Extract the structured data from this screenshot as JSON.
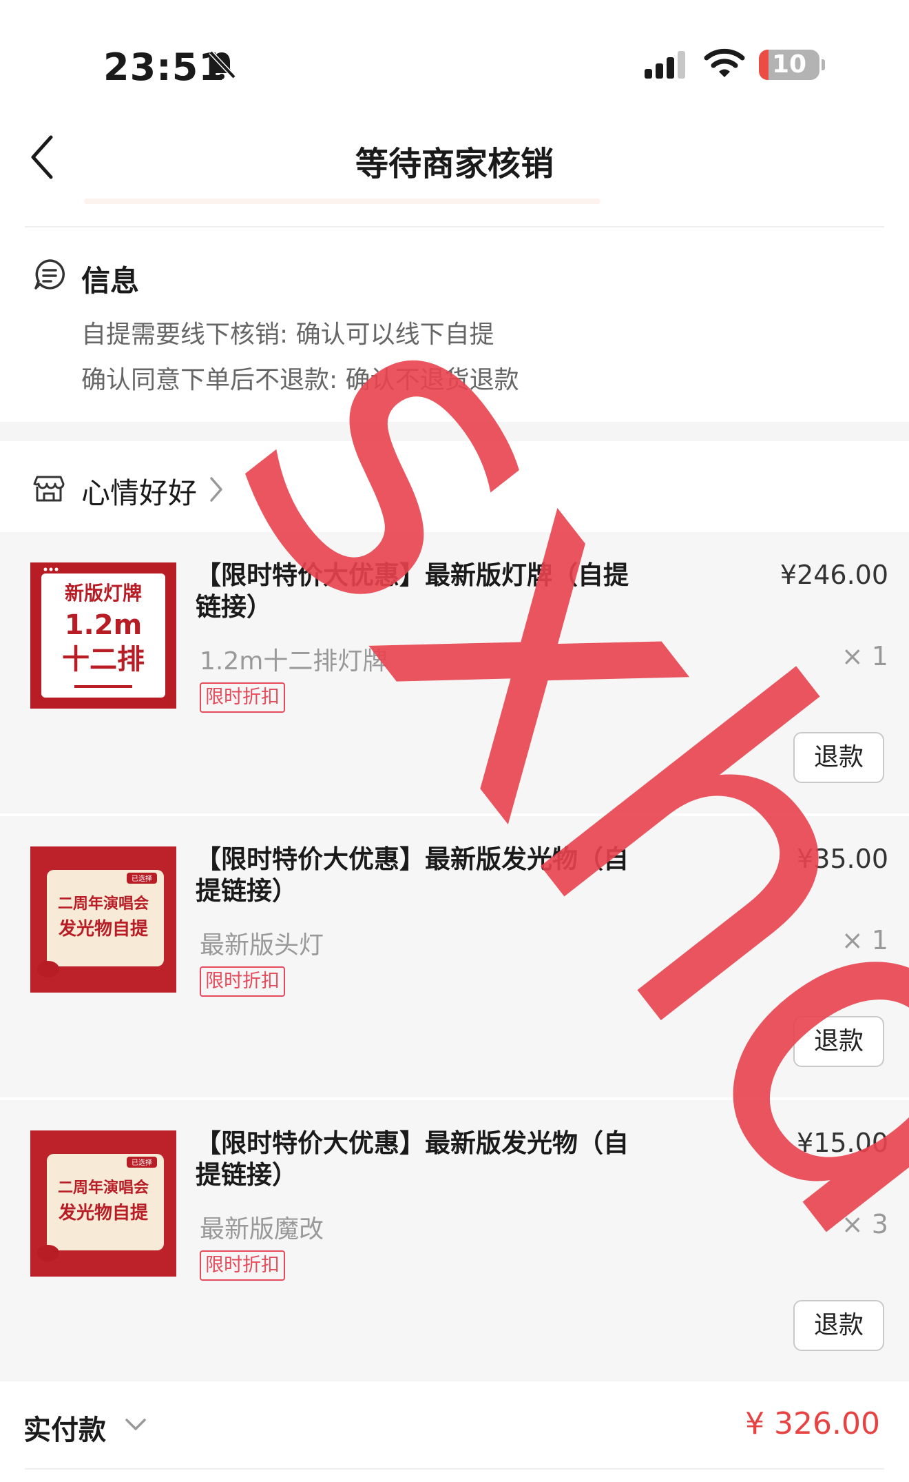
{
  "status_bar": {
    "time": "23:51",
    "battery": "10",
    "icons": [
      "bell-slash-icon",
      "signal-icon",
      "wifi-icon",
      "battery-icon"
    ]
  },
  "nav": {
    "title": "等待商家核销",
    "back_icon": "chevron-left-icon"
  },
  "info": {
    "title": "信息",
    "lines": [
      "自提需要线下核销: 确认可以线下自提",
      "确认同意下单后不退款: 确认不退货退款"
    ]
  },
  "shop": {
    "name": "心情好好"
  },
  "items": [
    {
      "title": "【限时特价大优惠】最新版灯牌（自提链接）",
      "price": "¥246.00",
      "spec": "1.2m十二排灯牌",
      "qty": "× 1",
      "tag": "限时折扣",
      "refund": "退款",
      "thumb": {
        "title": "新版灯牌",
        "size": "1.2m",
        "rows": "十二排"
      }
    },
    {
      "title": "【限时特价大优惠】最新版发光物（自提链接）",
      "price": "¥35.00",
      "spec": "最新版头灯",
      "qty": "× 1",
      "tag": "限时折扣",
      "refund": "退款",
      "thumb": {
        "badge": "已选择",
        "line1": "二周年演唱会",
        "line2": "发光物自提"
      }
    },
    {
      "title": "【限时特价大优惠】最新版发光物（自提链接）",
      "price": "¥15.00",
      "spec": "最新版魔改",
      "qty": "× 3",
      "tag": "限时折扣",
      "refund": "退款",
      "thumb": {
        "badge": "已选择",
        "line1": "二周年演唱会",
        "line2": "发光物自提"
      }
    }
  ],
  "total": {
    "label": "实付款",
    "value": "¥ 326.00"
  },
  "watermark": {
    "text": "sxhd"
  },
  "colors": {
    "accent": "#e84242",
    "tag": "#e64b5b",
    "thumb_red": "#b81c24"
  }
}
